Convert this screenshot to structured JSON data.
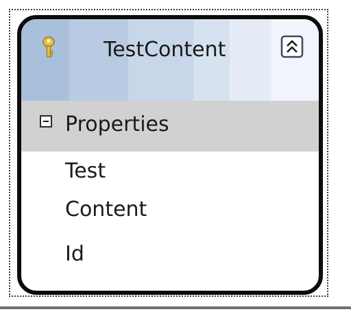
{
  "entity": {
    "title": "TestContent",
    "icon": "key-icon",
    "collapse_icon": "double-chevron-up-icon",
    "header_color": "#b8cbe2",
    "border_color": "#0c0c0c"
  },
  "section": {
    "label": "Properties",
    "toggle_icon": "minus-icon",
    "background": "#d1d1d1",
    "properties": [
      {
        "name": "Test"
      },
      {
        "name": "Content"
      },
      {
        "name": "Id"
      }
    ]
  }
}
